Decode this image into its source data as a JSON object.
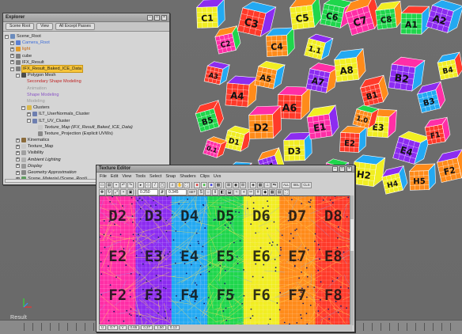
{
  "explorer": {
    "title": "Explorer",
    "tabs": [
      "Scene Root",
      "View",
      "All Except Passes"
    ],
    "tree": [
      {
        "label": "Scene_Root",
        "depth": 0,
        "expander": "−",
        "icon": "scene-root-icon",
        "color": ""
      },
      {
        "label": "Camera_Root",
        "depth": 1,
        "expander": "+",
        "icon": "camera-icon",
        "color": "c-blue"
      },
      {
        "label": "light",
        "depth": 1,
        "expander": "+",
        "icon": "light-icon",
        "color": "c-orange"
      },
      {
        "label": "cube",
        "depth": 1,
        "expander": "+",
        "icon": "polymesh-icon",
        "color": ""
      },
      {
        "label": "IFX_Result",
        "depth": 1,
        "expander": "+",
        "icon": "polymesh-icon",
        "color": ""
      },
      {
        "label": "IFX_Result_Baked_ICE_Data",
        "depth": 1,
        "expander": "−",
        "icon": "polymesh-icon",
        "color": "",
        "selected": true
      },
      {
        "label": "Polygon Mesh",
        "depth": 2,
        "expander": "−",
        "icon": "geometry-icon",
        "color": ""
      },
      {
        "label": "Secondary Shape Modeling",
        "depth": 3,
        "expander": "",
        "icon": "",
        "color": "c-red"
      },
      {
        "label": "Animation",
        "depth": 3,
        "expander": "",
        "icon": "",
        "color": "c-grey"
      },
      {
        "label": "Shape Modeling",
        "depth": 3,
        "expander": "",
        "icon": "",
        "color": "c-violet"
      },
      {
        "label": "Modeling",
        "depth": 3,
        "expander": "",
        "icon": "",
        "color": "c-grey"
      },
      {
        "label": "Clusters",
        "depth": 3,
        "expander": "−",
        "icon": "folder-icon",
        "color": ""
      },
      {
        "label": "ILT_UserNormals_Cluster",
        "depth": 4,
        "expander": "+",
        "icon": "cluster-icon",
        "color": ""
      },
      {
        "label": "ILT_UV_Cluster",
        "depth": 4,
        "expander": "−",
        "icon": "cluster-icon",
        "color": ""
      },
      {
        "label": "Texture_Map (IFX_Result_Baked_ICE_Data)",
        "depth": 5,
        "expander": "",
        "icon": "texture-map-icon",
        "color": "",
        "italic": true
      },
      {
        "label": "Texture_Projection (Explicit UVWs)",
        "depth": 5,
        "expander": "",
        "icon": "projection-icon",
        "color": ""
      },
      {
        "label": "Kinematics",
        "depth": 2,
        "expander": "+",
        "icon": "kinematics-icon",
        "color": ""
      },
      {
        "label": "Texture_Map",
        "depth": 2,
        "expander": "+",
        "icon": "texture-map-icon",
        "color": ""
      },
      {
        "label": "Visibility",
        "depth": 2,
        "expander": "+",
        "icon": "visibility-icon",
        "color": ""
      },
      {
        "label": "Ambient Lighting",
        "depth": 2,
        "expander": "+",
        "icon": "ambient-icon",
        "color": "",
        "italic": true
      },
      {
        "label": "Display",
        "depth": 2,
        "expander": "+",
        "icon": "display-icon",
        "color": "",
        "italic": true
      },
      {
        "label": "Geometry Approximation",
        "depth": 2,
        "expander": "+",
        "icon": "geometry-approx-icon",
        "color": "",
        "italic": true
      },
      {
        "label": "Scene_Material (Scene_Root)",
        "depth": 2,
        "expander": "+",
        "icon": "material-icon",
        "color": "",
        "italic": true
      }
    ]
  },
  "texture_editor": {
    "title": "Texture Editor",
    "menus": [
      "File",
      "Edit",
      "View",
      "Tools",
      "Select",
      "Snap",
      "Shaders",
      "Clips",
      "Uvs"
    ],
    "toolbar": {
      "field_u": "0.250",
      "field_v": "0.345",
      "labels": [
        "ALL",
        "SEL",
        "CLS"
      ],
      "set_label": "SET"
    },
    "status": [
      "U",
      "0.7",
      "V",
      "0.65",
      "0.27",
      "1.50",
      "0.13"
    ]
  },
  "viewport": {
    "status_label": "Result",
    "cube_labels": [
      "C1",
      "C2",
      "C3",
      "C4",
      "C5",
      "C6",
      "C7",
      "C8",
      "A1",
      "A2",
      "A3",
      "A4",
      "A5",
      "A6",
      "A7",
      "A8",
      "B1",
      "B2",
      "B3",
      "B4",
      "B5",
      "D1",
      "D2",
      "D3",
      "E1",
      "E2",
      "E3",
      "E4",
      "F1",
      "F2",
      "F3",
      "G1",
      "G2",
      "H1",
      "H2",
      "H4",
      "H5",
      "1.0",
      "1.1",
      "0.1"
    ]
  },
  "uv_view": {
    "columns": [
      {
        "color": "#ff2ea6",
        "labels": [
          "D2",
          "E2",
          "F2"
        ]
      },
      {
        "color": "#8c2cf0",
        "labels": [
          "D3",
          "E3",
          "F3"
        ]
      },
      {
        "color": "#23a9f2",
        "labels": [
          "D4",
          "E4",
          "F4"
        ]
      },
      {
        "color": "#1fd64c",
        "labels": [
          "D5",
          "E5",
          "F5"
        ]
      },
      {
        "color": "#f1ee22",
        "labels": [
          "D6",
          "E6",
          "F6"
        ]
      },
      {
        "color": "#ff8b1a",
        "labels": [
          "D7",
          "E7",
          "F7"
        ]
      },
      {
        "color": "#ff3a2a",
        "labels": [
          "D8",
          "E8",
          "F8"
        ]
      }
    ]
  },
  "colors": {
    "selection": "#f6c43a",
    "panel": "#d5d5d5",
    "viewport": "#6f6f6f"
  }
}
